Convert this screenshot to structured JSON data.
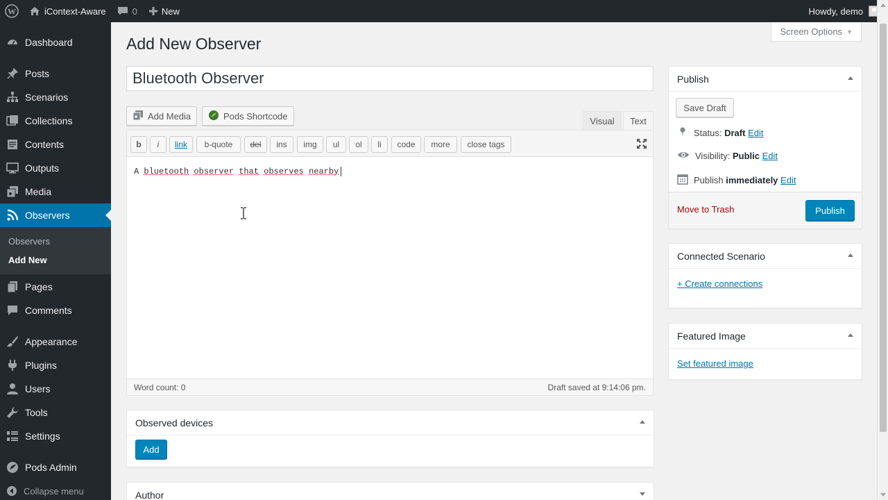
{
  "adminbar": {
    "site_name": "iContext-Aware",
    "comments_count": "0",
    "new_label": "New",
    "greeting": "Howdy, demo"
  },
  "sidebar": {
    "items": [
      {
        "label": "Dashboard",
        "icon": "dashboard-icon"
      },
      {
        "label": "Posts",
        "icon": "pin-icon"
      },
      {
        "label": "Scenarios",
        "icon": "network-icon"
      },
      {
        "label": "Collections",
        "icon": "collection-icon"
      },
      {
        "label": "Contents",
        "icon": "document-icon"
      },
      {
        "label": "Outputs",
        "icon": "monitor-icon"
      },
      {
        "label": "Media",
        "icon": "media-icon"
      },
      {
        "label": "Observers",
        "icon": "rss-icon"
      },
      {
        "label": "Pages",
        "icon": "page-icon"
      },
      {
        "label": "Comments",
        "icon": "comment-icon"
      },
      {
        "label": "Appearance",
        "icon": "brush-icon"
      },
      {
        "label": "Plugins",
        "icon": "plugin-icon"
      },
      {
        "label": "Users",
        "icon": "user-icon"
      },
      {
        "label": "Tools",
        "icon": "wrench-icon"
      },
      {
        "label": "Settings",
        "icon": "settings-icon"
      },
      {
        "label": "Pods Admin",
        "icon": "pods-icon"
      }
    ],
    "submenu": [
      "Observers",
      "Add New"
    ],
    "collapse_label": "Collapse menu"
  },
  "screen_options": "Screen Options",
  "page_title": "Add New Observer",
  "post_title": "Bluetooth Observer",
  "media_buttons": {
    "add_media": "Add Media",
    "pods_shortcode": "Pods Shortcode"
  },
  "editor_tabs": {
    "visual": "Visual",
    "text": "Text"
  },
  "quicktags": [
    "b",
    "i",
    "link",
    "b-quote",
    "del",
    "ins",
    "img",
    "ul",
    "ol",
    "li",
    "code",
    "more",
    "close tags"
  ],
  "editor": {
    "content_prefix": "A",
    "content_words": [
      "bluetooth",
      "observer",
      "that",
      "observes",
      "nearby"
    ],
    "word_count": "Word count: 0",
    "draft_saved": "Draft saved at 9:14:06 pm."
  },
  "publish_box": {
    "title": "Publish",
    "save_draft": "Save Draft",
    "status_label": "Status:",
    "status_value": "Draft",
    "visibility_label": "Visibility:",
    "visibility_value": "Public",
    "publish_label": "Publish",
    "publish_value": "immediately",
    "edit": "Edit",
    "move_to_trash": "Move to Trash",
    "publish_button": "Publish"
  },
  "connected_scenario": {
    "title": "Connected Scenario",
    "link": "+ Create connections"
  },
  "featured_image": {
    "title": "Featured Image",
    "link": "Set featured image"
  },
  "observed_devices": {
    "title": "Observed devices",
    "add_button": "Add"
  },
  "author_box": {
    "title": "Author"
  },
  "colors": {
    "admin_dark": "#23282d",
    "accent": "#0073aa",
    "primary_button": "#0085ba",
    "trash": "#a00"
  }
}
